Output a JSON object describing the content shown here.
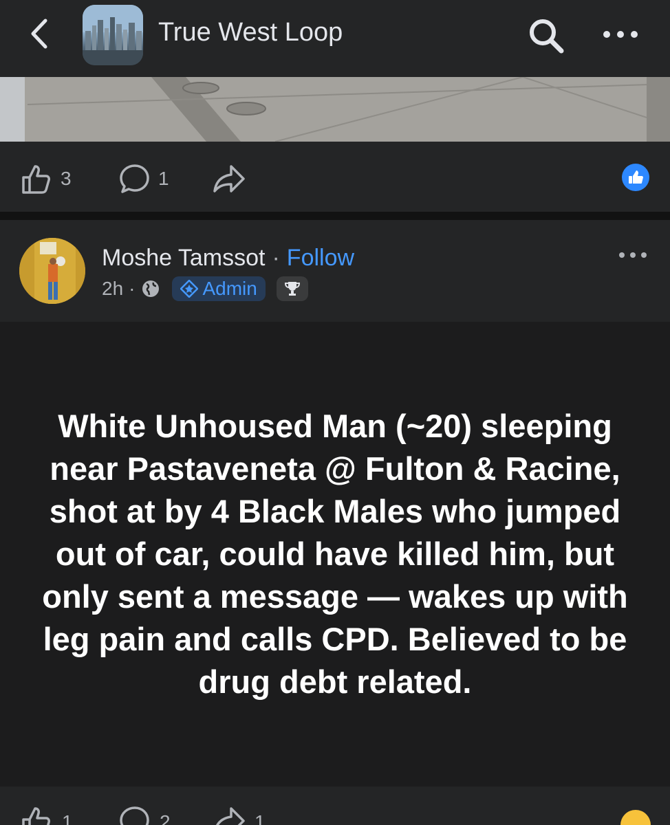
{
  "header": {
    "title": "True West Loop",
    "back_icon": "chevron-left-icon",
    "search_icon": "search-icon",
    "more_icon": "more-horizontal-icon"
  },
  "previous_post": {
    "like_count": "3",
    "comment_count": "1"
  },
  "post": {
    "author": "Moshe Tamssot",
    "separator": "·",
    "follow_label": "Follow",
    "time": "2h",
    "meta_separator": "·",
    "admin_label": "Admin",
    "text": "White Unhoused Man (~20) sleeping near Pastaveneta @ Fulton & Racine, shot at by 4 Black Males who jumped out of car, could have killed him, but only sent a message — wakes up with leg pain and calls CPD. Believed to be drug debt related."
  },
  "bottom_actions": {
    "like_count": "1",
    "comment_count": "2",
    "share_count": "1"
  },
  "colors": {
    "background": "#18191a",
    "card": "#242526",
    "post_body": "#1c1c1d",
    "accent": "#4599ff",
    "secondary_text": "#b0b3b8"
  }
}
